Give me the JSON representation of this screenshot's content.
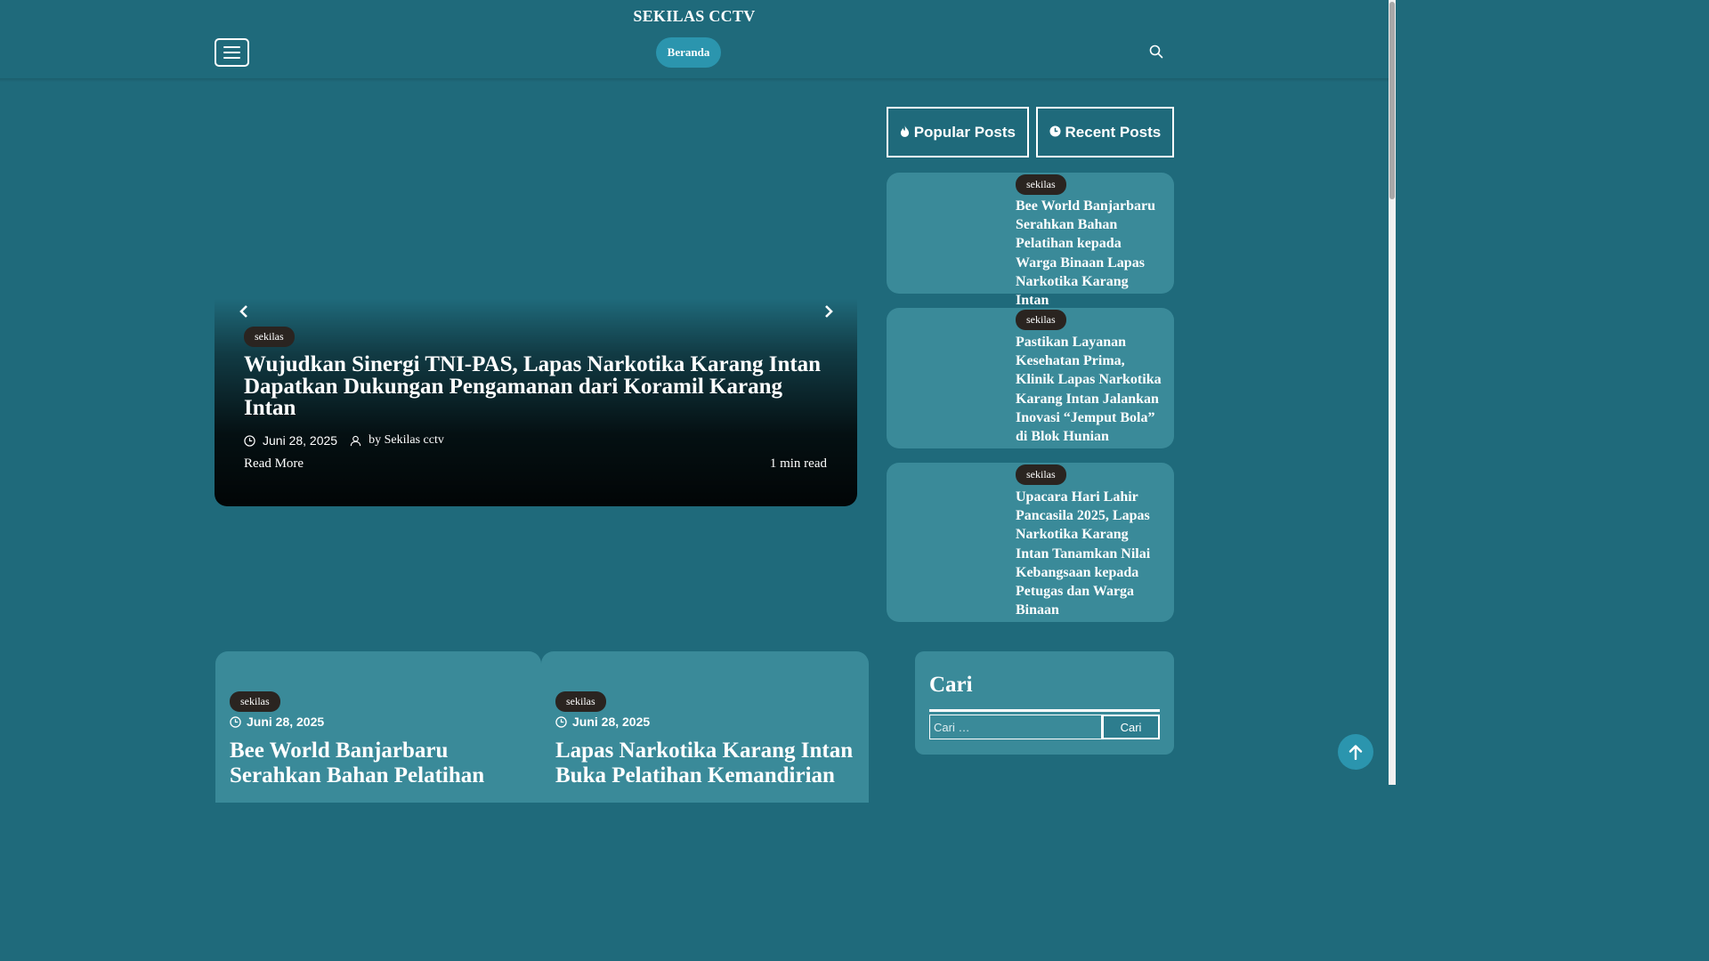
{
  "header": {
    "site_title": "SEKILAS CCTV",
    "nav_home": "Beranda"
  },
  "slider": {
    "category": "sekilas",
    "title": "Wujudkan Sinergi TNI-PAS, Lapas Narkotika Karang Intan Dapatkan Dukungan Pengamanan dari Koramil Karang Intan",
    "date": "Juni 28, 2025",
    "author": "by Sekilas cctv",
    "read_more": "Read More",
    "read_time": "1 min read"
  },
  "tabs": {
    "popular": "Popular Posts",
    "recent": "Recent Posts"
  },
  "side_posts": [
    {
      "category": "sekilas",
      "title": "Bee World Banjarbaru Serahkan Bahan Pelatihan kepada Warga Binaan Lapas Narkotika Karang Intan"
    },
    {
      "category": "sekilas",
      "title": "Pastikan Layanan Kesehatan Prima, Klinik Lapas Narkotika Karang Intan Jalankan Inovasi “Jemput Bola” di Blok Hunian"
    },
    {
      "category": "sekilas",
      "title": "Upacara Hari Lahir Pancasila 2025, Lapas Narkotika Karang Intan Tanamkan Nilai Kebangsaan kepada Petugas dan Warga Binaan"
    }
  ],
  "cards": [
    {
      "category": "sekilas",
      "date": "Juni 28, 2025",
      "title": "Bee World Banjarbaru Serahkan Bahan Pelatihan"
    },
    {
      "category": "sekilas",
      "date": "Juni 28, 2025",
      "title": "Lapas Narkotika Karang Intan Buka Pelatihan Kemandirian"
    }
  ],
  "search_widget": {
    "title": "Cari",
    "placeholder": "Cari …",
    "button": "Cari"
  }
}
